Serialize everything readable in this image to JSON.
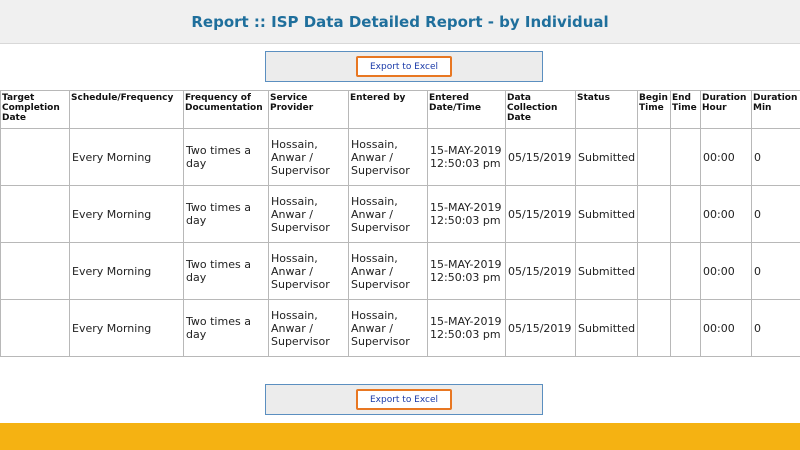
{
  "page": {
    "title": "Report :: ISP Data Detailed Report - by Individual"
  },
  "export": {
    "top_label": "Export to Excel",
    "bottom_label": "Export to Excel"
  },
  "table": {
    "headers": [
      "Target Completion Date",
      "Schedule/Frequency",
      "Frequency of Documentation",
      "Service Provider",
      "Entered by",
      "Entered Date/Time",
      "Data Collection Date",
      "Status",
      "Begin Time",
      "End Time",
      "Duration Hour",
      "Duration Min"
    ],
    "rows": [
      [
        "",
        "Every Morning",
        "Two times a day",
        "Hossain, Anwar / Supervisor",
        "Hossain, Anwar / Supervisor",
        "15-MAY-2019 12:50:03 pm",
        "05/15/2019",
        "Submitted",
        "",
        "",
        "00:00",
        "0"
      ],
      [
        "",
        "Every Morning",
        "Two times a day",
        "Hossain, Anwar / Supervisor",
        "Hossain, Anwar / Supervisor",
        "15-MAY-2019 12:50:03 pm",
        "05/15/2019",
        "Submitted",
        "",
        "",
        "00:00",
        "0"
      ],
      [
        "",
        "Every Morning",
        "Two times a day",
        "Hossain, Anwar / Supervisor",
        "Hossain, Anwar / Supervisor",
        "15-MAY-2019 12:50:03 pm",
        "05/15/2019",
        "Submitted",
        "",
        "",
        "00:00",
        "0"
      ],
      [
        "",
        "Every Morning",
        "Two times a day",
        "Hossain, Anwar / Supervisor",
        "Hossain, Anwar / Supervisor",
        "15-MAY-2019 12:50:03 pm",
        "05/15/2019",
        "Submitted",
        "",
        "",
        "00:00",
        "0"
      ]
    ]
  },
  "colors": {
    "title": "#1f6f9c",
    "export_border": "#e87722",
    "export_text": "#1a3aa8",
    "footer": "#f5b212"
  }
}
